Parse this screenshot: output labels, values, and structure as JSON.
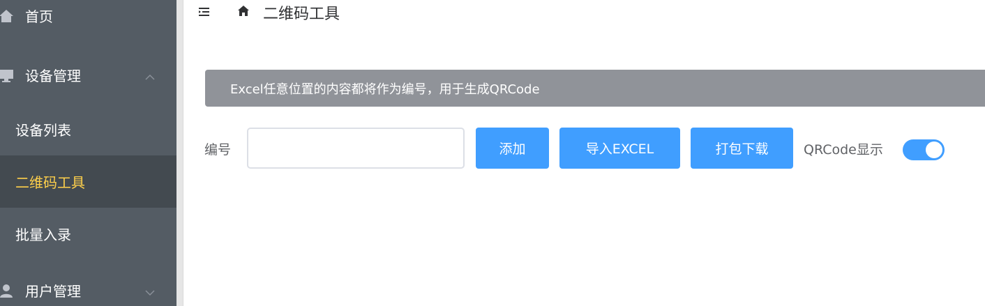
{
  "sidebar": {
    "items": [
      {
        "label": "首页",
        "icon": "home-icon"
      },
      {
        "label": "设备管理",
        "icon": "monitor-icon",
        "expanded": true,
        "children": [
          {
            "label": "设备列表",
            "active": false
          },
          {
            "label": "二维码工具",
            "active": true
          },
          {
            "label": "批量入录",
            "active": false
          }
        ]
      },
      {
        "label": "用户管理",
        "icon": "user-icon",
        "expanded": false
      }
    ],
    "colors": {
      "background": "#545c64",
      "active_background": "#434a50",
      "active_text": "#ffd04b",
      "text": "#ffffff"
    }
  },
  "header": {
    "toggle_icon": "menu-fold-icon",
    "home_icon": "home-icon",
    "breadcrumb": "二维码工具"
  },
  "alert": {
    "text": "Excel任意位置的内容都将作为编号，用于生成QRCode",
    "color": "#909399"
  },
  "form": {
    "label": "编号",
    "input_value": "",
    "input_placeholder": "",
    "buttons": {
      "add": "添加",
      "import": "导入EXCEL",
      "download": "打包下载"
    },
    "switch": {
      "label": "QRCode显示",
      "on": true
    },
    "accent": "#409eff"
  }
}
